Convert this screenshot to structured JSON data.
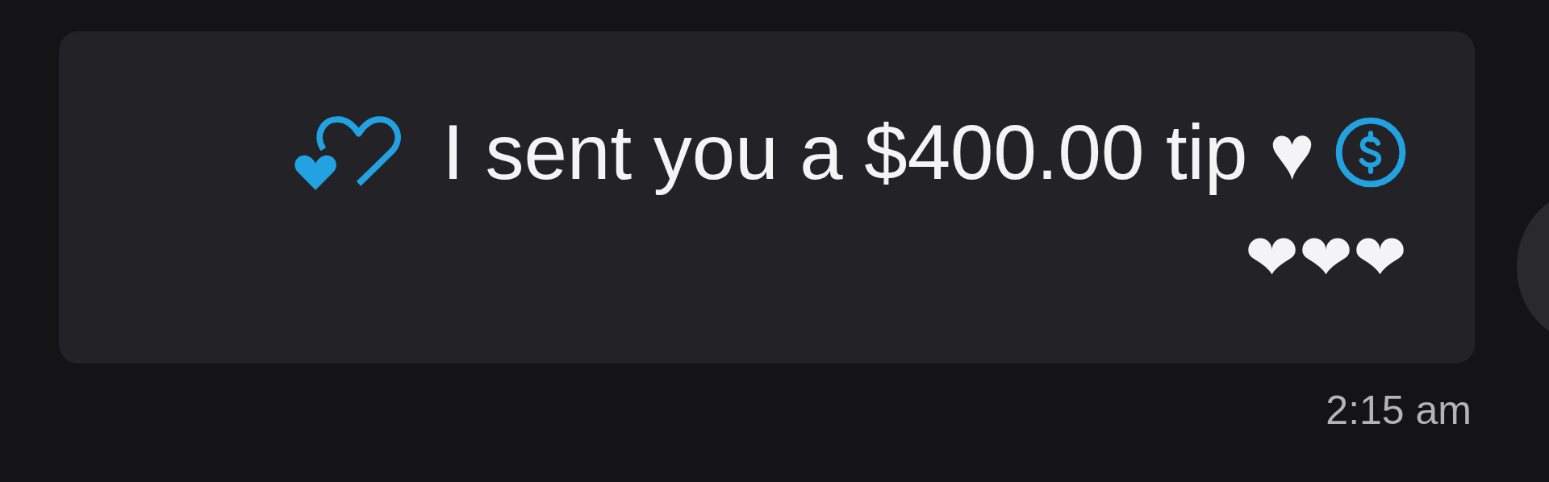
{
  "message": {
    "text": "I sent you a $400.00 tip ♥",
    "hearts": "❤❤❤",
    "time": "2:15 am"
  }
}
